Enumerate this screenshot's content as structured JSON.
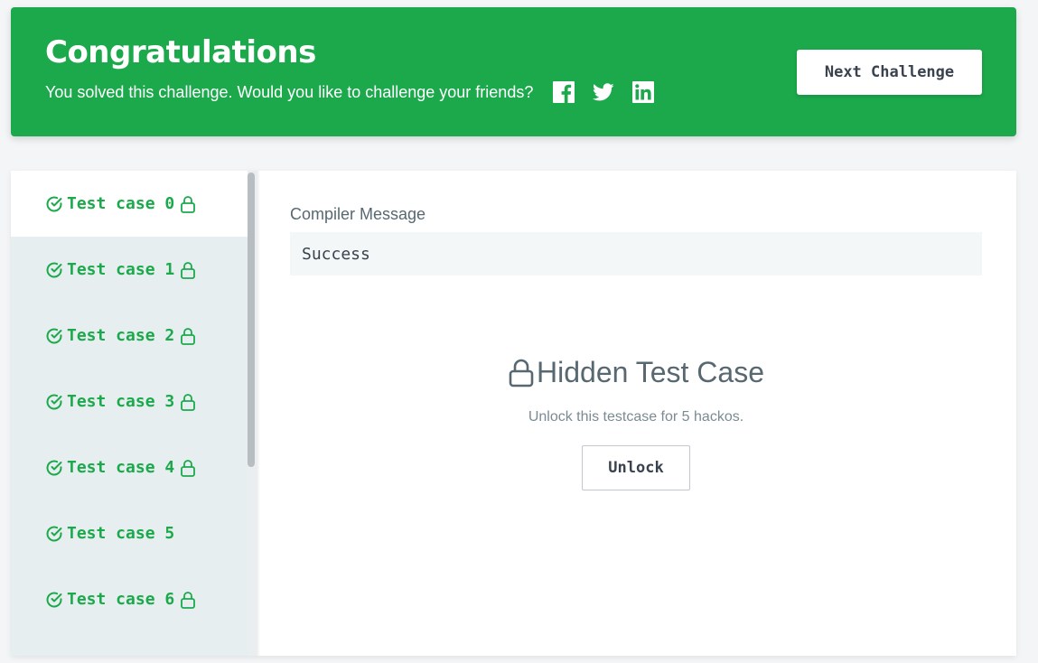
{
  "banner": {
    "title": "Congratulations",
    "subtitle": "You solved this challenge. Would you like to challenge your friends?",
    "social_icons": [
      "facebook-icon",
      "twitter-icon",
      "linkedin-icon"
    ],
    "next_button_label": "Next Challenge",
    "color": "#1ba94c"
  },
  "sidebar": {
    "test_cases": [
      {
        "label": "Test case 0",
        "passed": true,
        "locked": true,
        "active": true
      },
      {
        "label": "Test case 1",
        "passed": true,
        "locked": true,
        "active": false
      },
      {
        "label": "Test case 2",
        "passed": true,
        "locked": true,
        "active": false
      },
      {
        "label": "Test case 3",
        "passed": true,
        "locked": true,
        "active": false
      },
      {
        "label": "Test case 4",
        "passed": true,
        "locked": true,
        "active": false
      },
      {
        "label": "Test case 5",
        "passed": true,
        "locked": false,
        "active": false
      },
      {
        "label": "Test case 6",
        "passed": true,
        "locked": true,
        "active": false
      }
    ]
  },
  "main": {
    "compiler_label": "Compiler Message",
    "compiler_message": "Success",
    "hidden_title": "Hidden Test Case",
    "hidden_subtitle": "Unlock this testcase for 5 hackos.",
    "unlock_label": "Unlock"
  }
}
